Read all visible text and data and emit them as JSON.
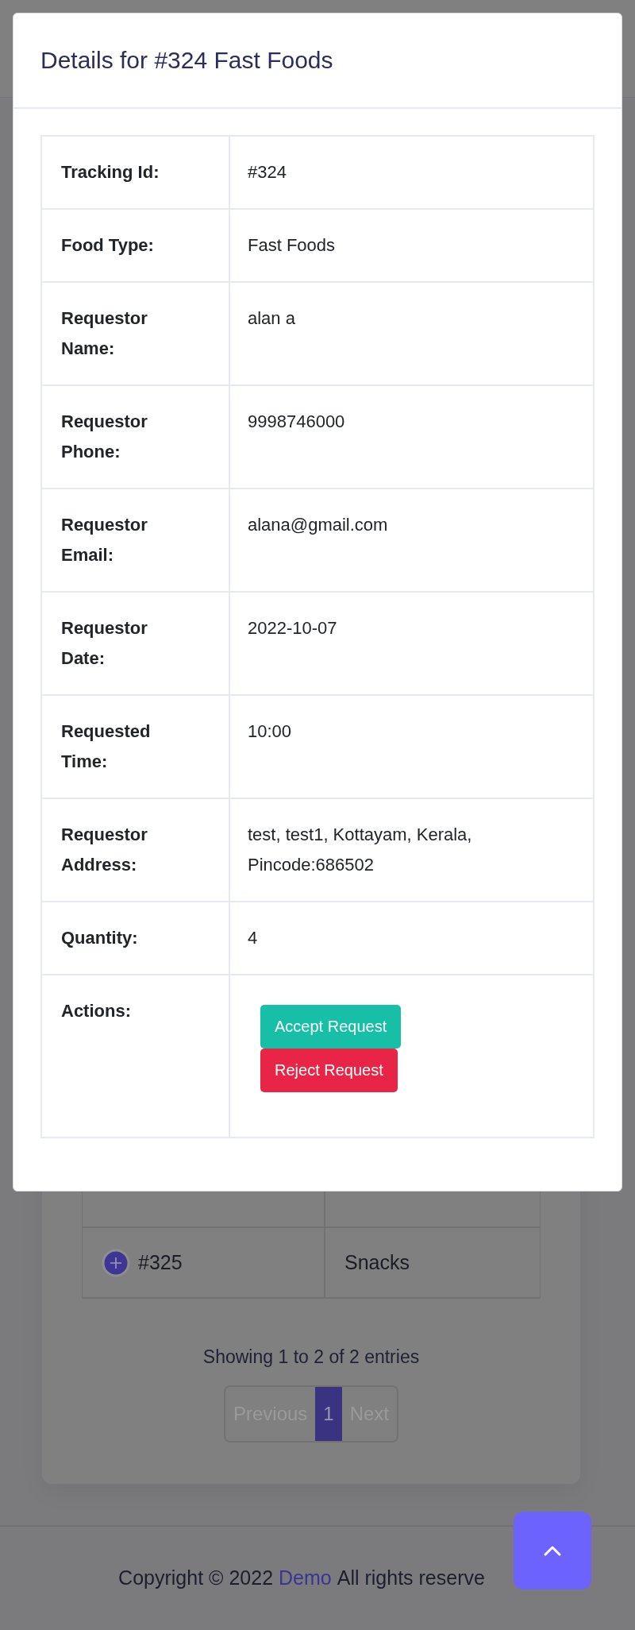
{
  "modal": {
    "title": "Details for #324 Fast Foods",
    "rows": [
      {
        "label": "Tracking Id:",
        "value": "#324"
      },
      {
        "label": "Food Type:",
        "value": "Fast Foods"
      },
      {
        "label": "Requestor Name:",
        "value": "alan a"
      },
      {
        "label": "Requestor Phone:",
        "value": "9998746000"
      },
      {
        "label": "Requestor Email:",
        "value": "alana@gmail.com"
      },
      {
        "label": "Requestor Date:",
        "value": "2022-10-07"
      },
      {
        "label": "Requested Time:",
        "value": "10:00"
      },
      {
        "label": "Requestor Address:",
        "value": "test, test1, Kottayam, Kerala, Pincode:686502"
      },
      {
        "label": "Quantity:",
        "value": "4"
      },
      {
        "label": "Actions:",
        "actions": [
          {
            "label": "Accept Request",
            "kind": "accept"
          },
          {
            "label": "Reject Request",
            "kind": "reject"
          }
        ]
      }
    ]
  },
  "background": {
    "table_rows": [
      {
        "column_1": "#325",
        "column_2": "Snacks"
      }
    ],
    "info": "Showing 1 to 2 of 2 entries",
    "pagination": [
      {
        "label": "Previous",
        "selected": false,
        "disabled": true
      },
      {
        "label": "1",
        "selected": true,
        "disabled": false
      },
      {
        "label": "Next",
        "selected": false,
        "disabled": true
      }
    ]
  },
  "footer": {
    "prefix": "Copyright © 2022",
    "link": "Demo",
    "suffix": "All rights reserve"
  }
}
